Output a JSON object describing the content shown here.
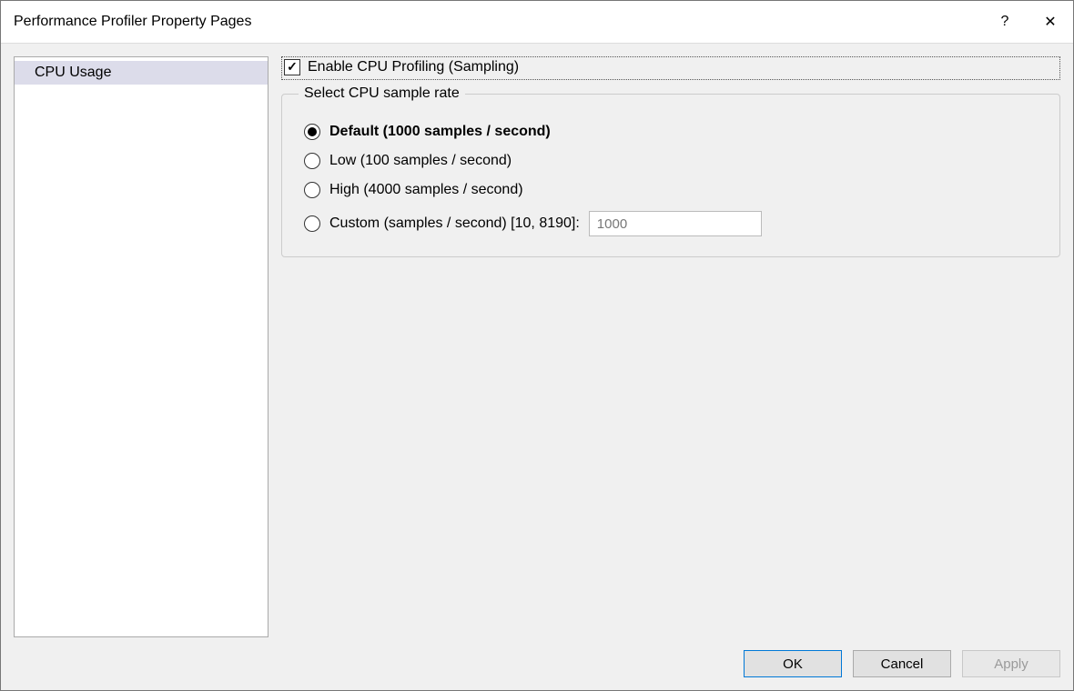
{
  "window": {
    "title": "Performance Profiler Property Pages",
    "help_symbol": "?",
    "close_symbol": "✕"
  },
  "sidebar": {
    "items": [
      {
        "label": "CPU Usage",
        "selected": true
      }
    ]
  },
  "content": {
    "enable_checkbox": {
      "label": "Enable CPU Profiling (Sampling)",
      "checked": true
    },
    "sample_rate_group": {
      "legend": "Select CPU sample rate",
      "options": [
        {
          "id": "default",
          "label": "Default (1000 samples / second)",
          "selected": true
        },
        {
          "id": "low",
          "label": "Low (100 samples / second)",
          "selected": false
        },
        {
          "id": "high",
          "label": "High (4000 samples / second)",
          "selected": false
        },
        {
          "id": "custom",
          "label": "Custom (samples / second) [10, 8190]:",
          "selected": false
        }
      ],
      "custom_value": "1000"
    }
  },
  "buttons": {
    "ok": "OK",
    "cancel": "Cancel",
    "apply": "Apply"
  }
}
